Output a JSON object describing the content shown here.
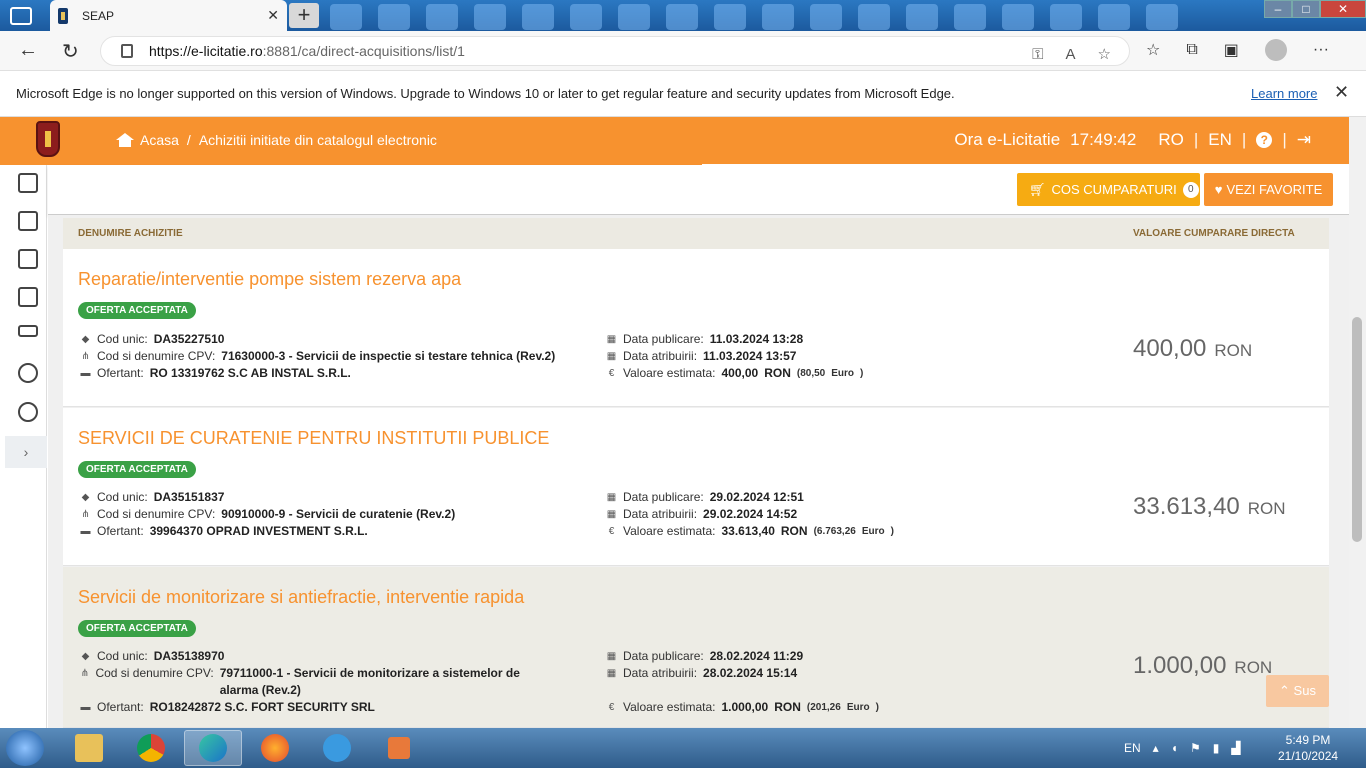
{
  "browser": {
    "tab_title": "SEAP",
    "tab_close": "✕",
    "new_tab": "+",
    "url_host": "https://e-licitatie.ro",
    "url_path": ":8881/ca/direct-acquisitions/list/1"
  },
  "infobar": {
    "message": "Microsoft Edge is no longer supported on this version of Windows. Upgrade to Windows 10 or later to get regular feature and security updates from Microsoft Edge.",
    "learn_more": "Learn more",
    "close": "✕"
  },
  "header": {
    "home": "Acasa",
    "separator": "/",
    "page": "Achizitii initiate din catalogul electronic",
    "clock_label": "Ora e-Licitatie",
    "clock_time": "17:49:42",
    "lang_ro": "RO",
    "lang_en": "EN",
    "pipe": "|"
  },
  "toolbar": {
    "cart_label": "COS CUMPARATURI",
    "cart_count": "0",
    "favorites_label": "VEZI FAVORITE"
  },
  "table": {
    "col_name": "DENUMIRE ACHIZITIE",
    "col_value": "VALOARE CUMPARARE DIRECTA"
  },
  "labels": {
    "cod_unic": "Cod unic:",
    "cpv": "Cod si denumire CPV:",
    "ofertant": "Ofertant:",
    "data_publicare": "Data publicare:",
    "data_atribuirii": "Data atribuirii:",
    "valoare_estimata": "Valoare estimata:",
    "ron": "RON",
    "euro": "Euro"
  },
  "rows": [
    {
      "title": "Reparatie/interventie pompe sistem rezerva apa",
      "status": "OFERTA ACCEPTATA",
      "cod": "DA35227510",
      "cpv": "71630000-3 - Servicii de inspectie si testare tehnica (Rev.2)",
      "ofertant": "RO 13319762 S.C AB INSTAL S.R.L.",
      "publicare": "11.03.2024 13:28",
      "atribuire": "11.03.2024 13:57",
      "estimata": "400,00",
      "estimata_euro": "(80,50",
      "valoare": "400,00"
    },
    {
      "title": "SERVICII DE CURATENIE PENTRU INSTITUTII PUBLICE",
      "status": "OFERTA ACCEPTATA",
      "cod": "DA35151837",
      "cpv": "90910000-9 - Servicii de curatenie (Rev.2)",
      "ofertant": "39964370 OPRAD INVESTMENT S.R.L.",
      "publicare": "29.02.2024 12:51",
      "atribuire": "29.02.2024 14:52",
      "estimata": "33.613,40",
      "estimata_euro": "(6.763,26",
      "valoare": "33.613,40"
    },
    {
      "title": "Servicii de monitorizare si antiefractie, interventie rapida",
      "status": "OFERTA ACCEPTATA",
      "cod": "DA35138970",
      "cpv": "79711000-1 - Servicii de monitorizare a sistemelor de alarma (Rev.2)",
      "ofertant": "RO18242872 S.C. FORT SECURITY SRL",
      "publicare": "28.02.2024 11:29",
      "atribuire": "28.02.2024 15:14",
      "estimata": "1.000,00",
      "estimata_euro": "(201,26",
      "valoare": "1.000,00"
    }
  ],
  "scroll_top": "Sus",
  "rail_expand": "›",
  "taskbar": {
    "lang": "EN",
    "time": "5:49 PM",
    "date": "21/10/2024"
  },
  "colors": {
    "brand_orange": "#f7922f",
    "status_green": "#3aa146",
    "cart_yellow": "#f6ab12"
  }
}
